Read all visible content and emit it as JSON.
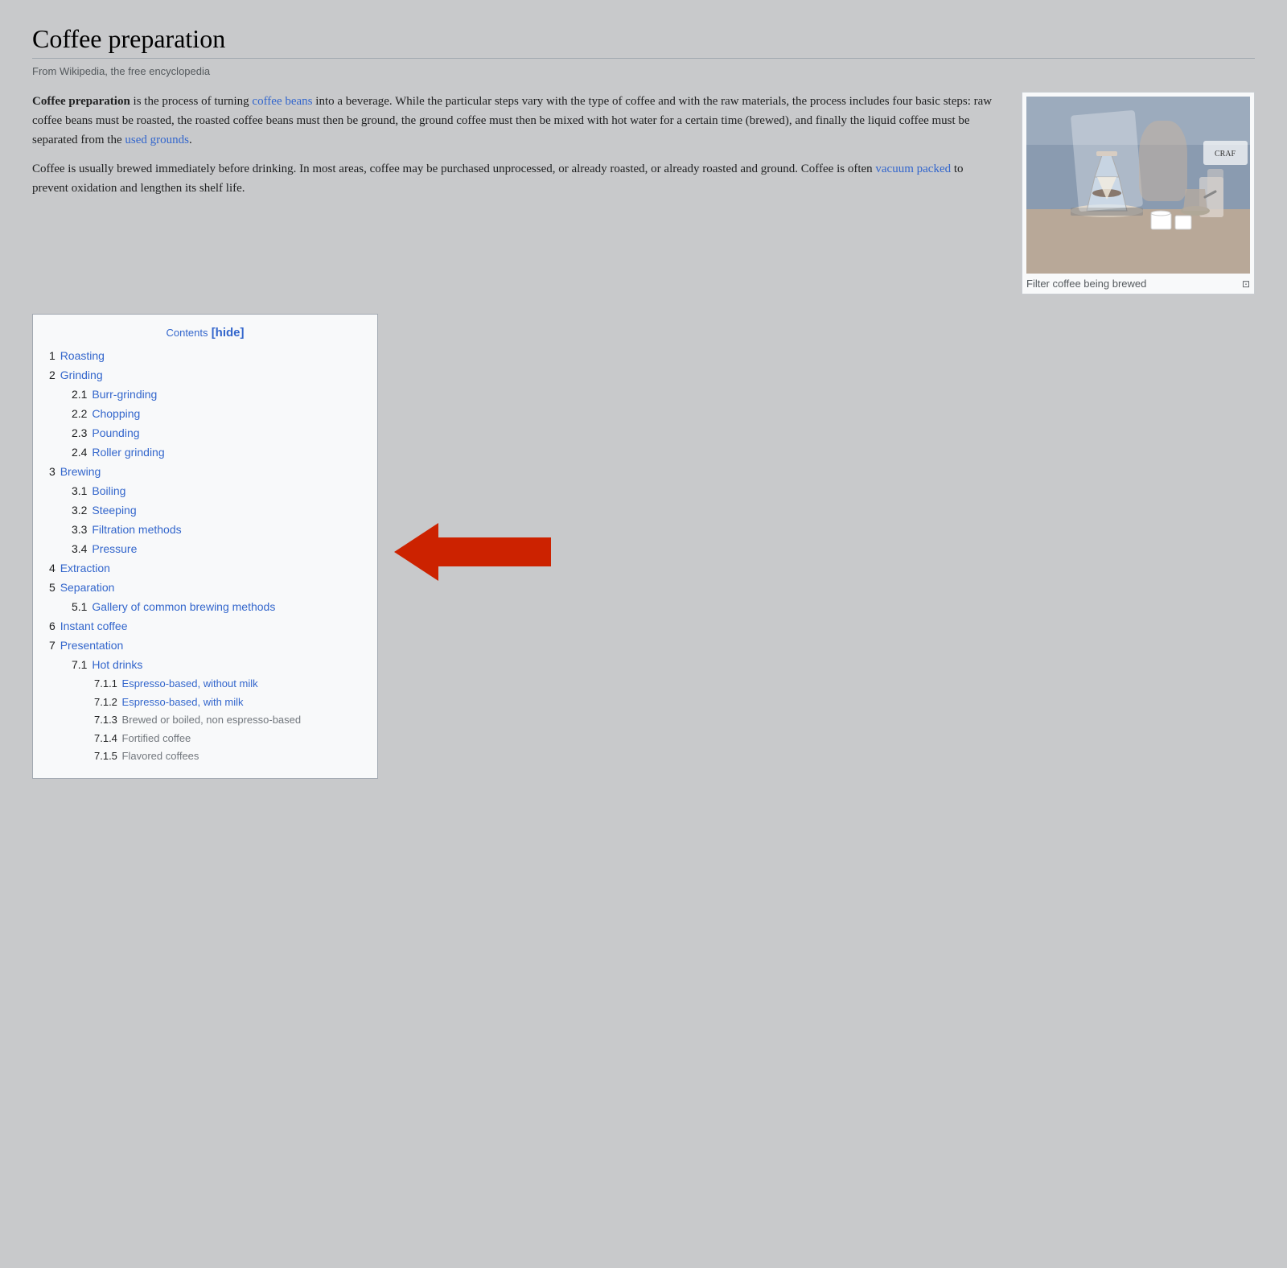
{
  "page": {
    "title": "Coffee preparation",
    "subtitle": "From Wikipedia, the free encyclopedia"
  },
  "article": {
    "intro1_bold": "Coffee preparation",
    "intro1_rest": " is the process of turning ",
    "intro1_link1": "coffee beans",
    "intro1_mid": " into a beverage. While the particular steps vary with the type of coffee and with the raw materials, the process includes four basic steps: raw coffee beans must be roasted, the roasted coffee beans must then be ground, the ground coffee must then be mixed with hot water for a certain time (brewed), and finally the liquid coffee must be separated from the ",
    "intro1_link2": "used grounds",
    "intro1_end": ".",
    "intro2_start": "Coffee is usually brewed immediately before drinking. In most areas, coffee may be purchased unprocessed, or already roasted, or already roasted and ground. Coffee is often ",
    "intro2_link": "vacuum packed",
    "intro2_end": " to prevent oxidation and lengthen its shelf life."
  },
  "image": {
    "caption": "Filter coffee being brewed"
  },
  "contents": {
    "title": "Contents",
    "hide_label": "[hide]",
    "items": [
      {
        "number": "1",
        "label": "Roasting",
        "level": 1
      },
      {
        "number": "2",
        "label": "Grinding",
        "level": 1
      },
      {
        "number": "2.1",
        "label": "Burr-grinding",
        "level": 2
      },
      {
        "number": "2.2",
        "label": "Chopping",
        "level": 2
      },
      {
        "number": "2.3",
        "label": "Pounding",
        "level": 2
      },
      {
        "number": "2.4",
        "label": "Roller grinding",
        "level": 2
      },
      {
        "number": "3",
        "label": "Brewing",
        "level": 1
      },
      {
        "number": "3.1",
        "label": "Boiling",
        "level": 2
      },
      {
        "number": "3.2",
        "label": "Steeping",
        "level": 2
      },
      {
        "number": "3.3",
        "label": "Filtration methods",
        "level": 2
      },
      {
        "number": "3.4",
        "label": "Pressure",
        "level": 2
      },
      {
        "number": "4",
        "label": "Extraction",
        "level": 1
      },
      {
        "number": "5",
        "label": "Separation",
        "level": 1
      },
      {
        "number": "5.1",
        "label": "Gallery of common brewing methods",
        "level": 2
      },
      {
        "number": "6",
        "label": "Instant coffee",
        "level": 1
      },
      {
        "number": "7",
        "label": "Presentation",
        "level": 1
      },
      {
        "number": "7.1",
        "label": "Hot drinks",
        "level": 2
      },
      {
        "number": "7.1.1",
        "label": "Espresso-based, without milk",
        "level": 3
      },
      {
        "number": "7.1.2",
        "label": "Espresso-based, with milk",
        "level": 3
      },
      {
        "number": "7.1.3",
        "label": "Brewed or boiled, non espresso-based",
        "level": 3,
        "faded": true
      },
      {
        "number": "7.1.4",
        "label": "Fortified coffee",
        "level": 3,
        "faded": true
      },
      {
        "number": "7.1.5",
        "label": "Flavored coffees",
        "level": 3,
        "faded": true
      }
    ]
  }
}
